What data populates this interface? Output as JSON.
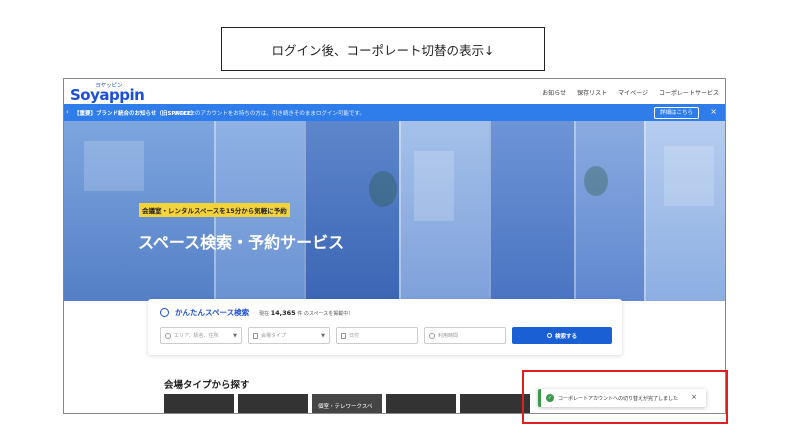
{
  "caption": "ログイン後、コーポレート切替の表示↓",
  "header": {
    "logo_main": "Soyappin",
    "logo_kana": "ヨヤッピン",
    "nav": [
      "お知らせ",
      "保存リスト",
      "マイページ",
      "コーポレートサービス"
    ]
  },
  "announcement": {
    "title": "【重要】ブランド統合のお知らせ（旧SPACEE）",
    "body": "SPACEEのアカウントをお持ちの方は、引き続きそのままログイン可能です。",
    "detail_button": "詳細はこちら",
    "close": "×"
  },
  "hero": {
    "badge": "会議室・レンタルスペースを15分から気軽に予約",
    "title": "スペース検索・予約サービス"
  },
  "search": {
    "title": "かんたんスペース検索",
    "count_prefix": "現在",
    "count": "14,365",
    "count_suffix": "件 のスペースを掲載中！",
    "area_placeholder": "エリア、駅名、住所",
    "type_placeholder": "会場タイプ",
    "date_placeholder": "日付",
    "time_placeholder": "利用時間",
    "button": "検索する"
  },
  "section": {
    "title": "会場タイプから探す",
    "tile_label": "個室・テレワークスペ"
  },
  "toast": {
    "message": "コーポレートアカウントへの切り替えが完了しました",
    "close": "×",
    "check": "✓"
  },
  "colors": {
    "brand": "#1b4fd8",
    "announce_bg": "#2f7dea",
    "badge_bg": "#f3d23a",
    "success": "#3a9a4a",
    "highlight": "#e02020"
  }
}
